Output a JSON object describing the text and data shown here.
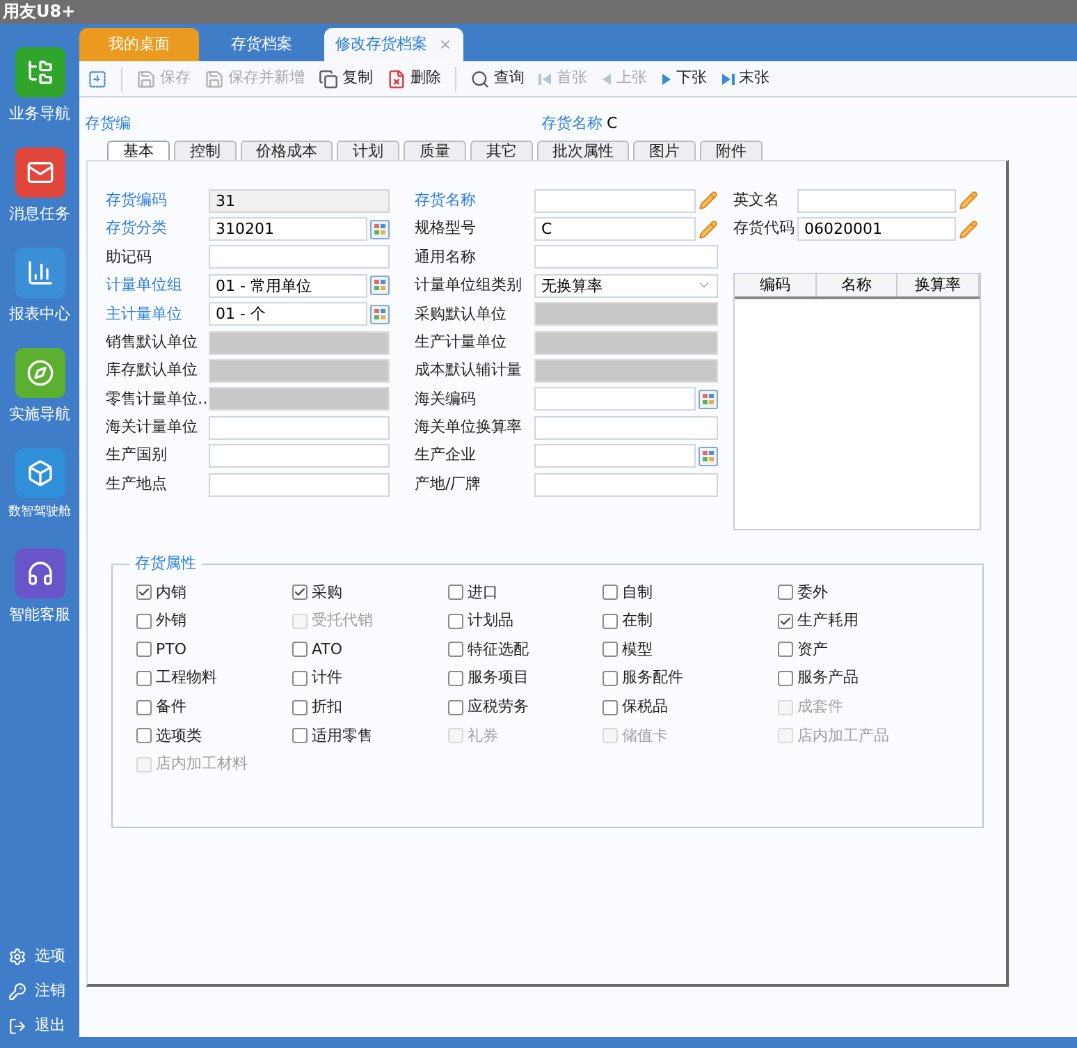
{
  "app_title": "用友U8+",
  "sidebar": {
    "items": [
      {
        "label": "业务导航",
        "color": "#2fa52c"
      },
      {
        "label": "消息任务",
        "color": "#e0463c"
      },
      {
        "label": "报表中心",
        "color": "#3b8fd6"
      },
      {
        "label": "实施导航",
        "color": "#5cb030"
      },
      {
        "label": "数智驾驶舱",
        "color": "#2f8fd8"
      },
      {
        "label": "智能客服",
        "color": "#6a55c8"
      }
    ],
    "footer": [
      {
        "label": "选项"
      },
      {
        "label": "注销"
      },
      {
        "label": "退出"
      }
    ]
  },
  "tabs": [
    {
      "label": "我的桌面",
      "kind": "home",
      "selected": false
    },
    {
      "label": "存货档案",
      "kind": "page",
      "selected": false
    },
    {
      "label": "修改存货档案",
      "kind": "page",
      "selected": true
    }
  ],
  "toolbar": [
    {
      "kind": "new"
    },
    {
      "kind": "save",
      "label": "保存",
      "disabled": true
    },
    {
      "kind": "save_new",
      "label": "保存并新增",
      "disabled": true
    },
    {
      "kind": "copy",
      "label": "复制",
      "disabled": false
    },
    {
      "kind": "delete",
      "label": "删除",
      "disabled": false
    },
    {
      "kind": "query",
      "label": "查询",
      "disabled": false
    },
    {
      "kind": "first",
      "label": "首张",
      "disabled": true
    },
    {
      "kind": "prev",
      "label": "上张",
      "disabled": true
    },
    {
      "kind": "next",
      "label": "下张",
      "disabled": false
    },
    {
      "kind": "last",
      "label": "末张",
      "disabled": false
    }
  ],
  "header": [
    {
      "label": "存货编"
    },
    {
      "label": "存货名称",
      "value": "C"
    }
  ],
  "form_tabs": [
    {
      "label": "基本",
      "selected": true
    },
    {
      "label": "控制",
      "selected": false
    },
    {
      "label": "价格成本",
      "selected": false
    },
    {
      "label": "计划",
      "selected": false
    },
    {
      "label": "质量",
      "selected": false
    },
    {
      "label": "其它",
      "selected": false
    },
    {
      "label": "批次属性",
      "selected": false
    },
    {
      "label": "图片",
      "selected": false
    },
    {
      "label": "附件",
      "selected": false
    }
  ],
  "fields_left": [
    {
      "label": "存货编码",
      "required": true,
      "kind": "readonly",
      "value": "31"
    },
    {
      "label": "存货分类",
      "required": true,
      "kind": "ref",
      "value": "310201"
    },
    {
      "label": "助记码",
      "required": false,
      "kind": "text"
    },
    {
      "label": "计量单位组",
      "required": true,
      "kind": "ref",
      "value": "01 - 常用单位"
    },
    {
      "label": "主计量单位",
      "required": true,
      "kind": "ref",
      "value": "01 - 个"
    },
    {
      "label": "销售默认单位",
      "required": false,
      "kind": "disabled"
    },
    {
      "label": "库存默认单位",
      "required": false,
      "kind": "disabled"
    },
    {
      "label": "零售计量单位…",
      "required": false,
      "kind": "disabled"
    },
    {
      "label": "海关计量单位",
      "required": false,
      "kind": "text"
    },
    {
      "label": "生产国别",
      "required": false,
      "kind": "text"
    },
    {
      "label": "生产地点",
      "required": false,
      "kind": "text"
    }
  ],
  "fields_middle": [
    {
      "label": "存货名称",
      "required": true,
      "kind": "edit"
    },
    {
      "label": "规格型号",
      "required": false,
      "kind": "edit",
      "value": "C"
    },
    {
      "label": "通用名称",
      "required": false,
      "kind": "text"
    },
    {
      "label": "计量单位组类别",
      "required": false,
      "kind": "select",
      "value": "无换算率"
    },
    {
      "label": "采购默认单位",
      "required": false,
      "kind": "disabled"
    },
    {
      "label": "生产计量单位",
      "required": false,
      "kind": "disabled"
    },
    {
      "label": "成本默认辅计量",
      "required": false,
      "kind": "disabled"
    },
    {
      "label": "海关编码",
      "required": false,
      "kind": "ref"
    },
    {
      "label": "海关单位换算率",
      "required": false,
      "kind": "text"
    },
    {
      "label": "生产企业",
      "required": false,
      "kind": "ref"
    },
    {
      "label": "产地/厂牌",
      "required": false,
      "kind": "text"
    }
  ],
  "fields_right": [
    {
      "label": "英文名",
      "required": false,
      "kind": "edit"
    },
    {
      "label": "存货代码",
      "required": false,
      "kind": "edit",
      "value": "06020001"
    }
  ],
  "unit_table": {
    "columns": [
      "编码",
      "名称",
      "换算率"
    ]
  },
  "attributes": {
    "title": "存货属性",
    "items": [
      {
        "label": "内销",
        "checked": true,
        "disabled": false
      },
      {
        "label": "采购",
        "checked": true,
        "disabled": false
      },
      {
        "label": "进口",
        "checked": false,
        "disabled": false
      },
      {
        "label": "自制",
        "checked": false,
        "disabled": false
      },
      {
        "label": "委外",
        "checked": false,
        "disabled": false
      },
      {
        "label": "外销",
        "checked": false,
        "disabled": false
      },
      {
        "label": "受托代销",
        "checked": false,
        "disabled": true
      },
      {
        "label": "计划品",
        "checked": false,
        "disabled": false
      },
      {
        "label": "在制",
        "checked": false,
        "disabled": false
      },
      {
        "label": "生产耗用",
        "checked": true,
        "disabled": false
      },
      {
        "label": "PTO",
        "checked": false,
        "disabled": false
      },
      {
        "label": "ATO",
        "checked": false,
        "disabled": false
      },
      {
        "label": "特征选配",
        "checked": false,
        "disabled": false
      },
      {
        "label": "模型",
        "checked": false,
        "disabled": false
      },
      {
        "label": "资产",
        "checked": false,
        "disabled": false
      },
      {
        "label": "工程物料",
        "checked": false,
        "disabled": false
      },
      {
        "label": "计件",
        "checked": false,
        "disabled": false
      },
      {
        "label": "服务项目",
        "checked": false,
        "disabled": false
      },
      {
        "label": "服务配件",
        "checked": false,
        "disabled": false
      },
      {
        "label": "服务产品",
        "checked": false,
        "disabled": false
      },
      {
        "label": "备件",
        "checked": false,
        "disabled": false
      },
      {
        "label": "折扣",
        "checked": false,
        "disabled": false
      },
      {
        "label": "应税劳务",
        "checked": false,
        "disabled": false
      },
      {
        "label": "保税品",
        "checked": false,
        "disabled": false
      },
      {
        "label": "成套件",
        "checked": false,
        "disabled": true
      },
      {
        "label": "选项类",
        "checked": false,
        "disabled": false
      },
      {
        "label": "适用零售",
        "checked": false,
        "disabled": false
      },
      {
        "label": "礼券",
        "checked": false,
        "disabled": true
      },
      {
        "label": "储值卡",
        "checked": false,
        "disabled": true
      },
      {
        "label": "店内加工产品",
        "checked": false,
        "disabled": true
      },
      {
        "label": "店内加工材料",
        "checked": false,
        "disabled": true
      }
    ]
  }
}
